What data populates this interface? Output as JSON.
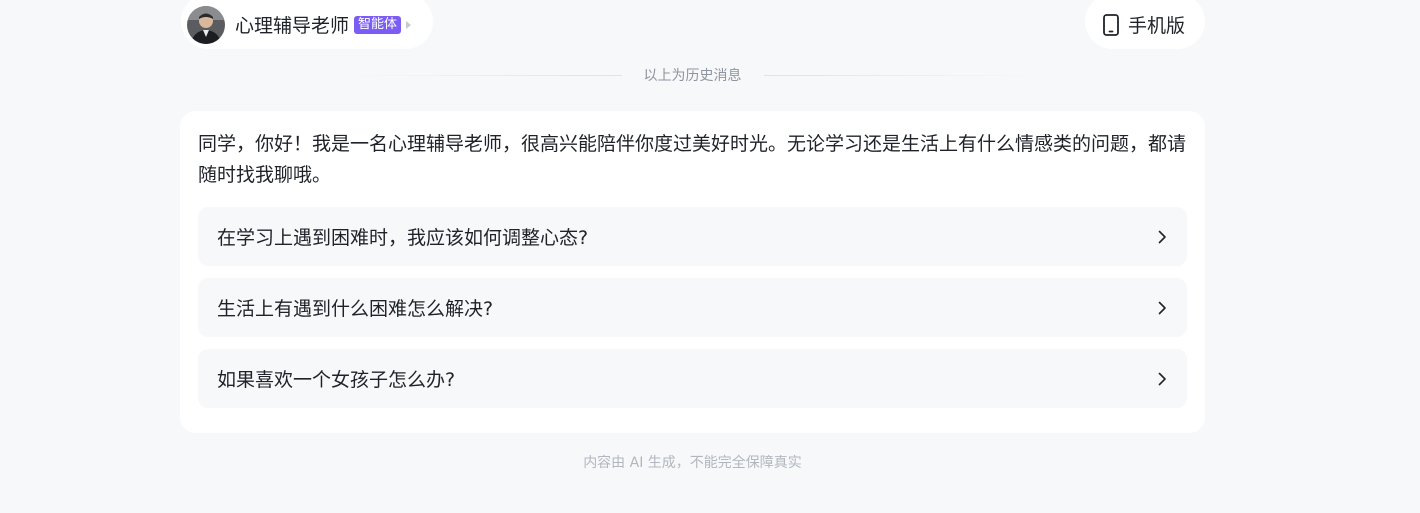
{
  "header": {
    "agent_name": "心理辅导老师",
    "agent_badge": "智能体",
    "mobile_label": "手机版",
    "avatar_icon": "person-avatar-icon",
    "mobile_icon": "phone-icon"
  },
  "history_divider": {
    "label": "以上为历史消息"
  },
  "message": {
    "greeting": "同学，你好！我是一名心理辅导老师，很高兴能陪伴你度过美好时光。无论学习还是生活上有什么情感类的问题，都请随时找我聊哦。",
    "suggestions": [
      "在学习上遇到困难时，我应该如何调整心态?",
      "生活上有遇到什么困难怎么解决?",
      "如果喜欢一个女孩子怎么办?"
    ],
    "suggestion_icon": "chevron-right-icon"
  },
  "footer": {
    "disclaimer": "内容由 AI 生成，不能完全保障真实"
  },
  "colors": {
    "background": "#f7f8fa",
    "card": "#ffffff",
    "badge": "#7b5cf5",
    "text_primary": "#1f2329",
    "text_secondary": "#8f959e",
    "text_muted": "#b2b7bf"
  }
}
